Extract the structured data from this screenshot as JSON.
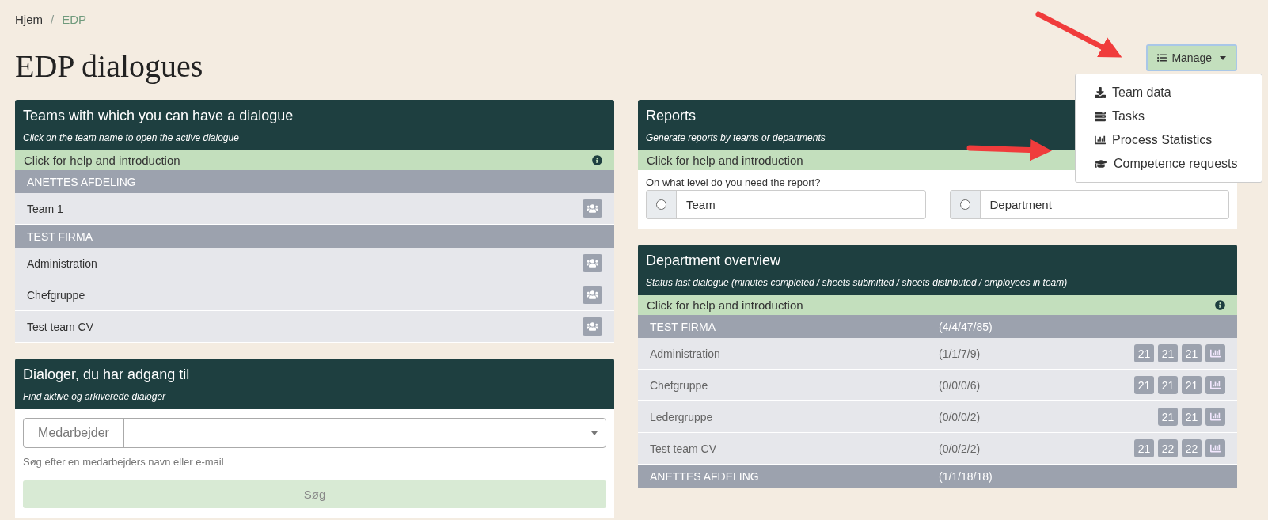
{
  "breadcrumb": [
    {
      "label": "Hjem",
      "active": false
    },
    {
      "label": "EDP",
      "active": true
    }
  ],
  "breadcrumb_separator": "/",
  "title": "EDP dialogues",
  "manage": {
    "label": "Manage",
    "expanded": true,
    "menu": [
      {
        "label": "Team data",
        "kind": "download"
      },
      {
        "label": "Tasks",
        "kind": "tasks"
      },
      {
        "label": "Process Statistics",
        "kind": "chart"
      },
      {
        "label": "Competence requests",
        "kind": "graduation"
      }
    ]
  },
  "teams_panel": {
    "title": "Teams with which you can have a dialogue",
    "subtitle": "Click on the team name to open the active dialogue",
    "help": "Click for help and introduction",
    "groups": [
      {
        "name": "ANETTES AFDELING",
        "teams": [
          "Team 1"
        ]
      },
      {
        "name": "TEST FIRMA",
        "teams": [
          "Administration",
          "Chefgruppe",
          "Test team CV"
        ]
      }
    ]
  },
  "dialogues_panel": {
    "title": "Dialoger, du har adgang til",
    "subtitle": "Find aktive og arkiverede dialoger",
    "field_label": "Medarbejder",
    "hint": "Søg efter en medarbejders navn eller e-mail",
    "search_button": {
      "label": "Søg",
      "disabled": true
    }
  },
  "reports_panel": {
    "title": "Reports",
    "subtitle": "Generate reports by teams or departments",
    "help": "Click for help and introduction",
    "question": "On what level do you need the report?",
    "options": [
      {
        "label": "Team",
        "selected": false
      },
      {
        "label": "Department",
        "selected": false
      }
    ]
  },
  "department_panel": {
    "title": "Department overview",
    "subtitle": "Status last dialogue (minutes completed / sheets submitted / sheets distributed / employees in team)",
    "help": "Click for help and introduction",
    "groups": [
      {
        "name": "TEST FIRMA",
        "status": "(4/4/47/85)",
        "rows": [
          {
            "name": "Administration",
            "status": "(1/1/7/9)",
            "buttons": [
              "21",
              "21",
              "21"
            ]
          },
          {
            "name": "Chefgruppe",
            "status": "(0/0/0/6)",
            "buttons": [
              "21",
              "21",
              "21"
            ]
          },
          {
            "name": "Ledergruppe",
            "status": "(0/0/0/2)",
            "buttons": [
              "21",
              "21"
            ]
          },
          {
            "name": "Test team CV",
            "status": "(0/0/2/2)",
            "buttons": [
              "21",
              "22",
              "22"
            ]
          }
        ]
      },
      {
        "name": "ANETTES AFDELING",
        "status": "(1/1/18/18)"
      }
    ]
  }
}
